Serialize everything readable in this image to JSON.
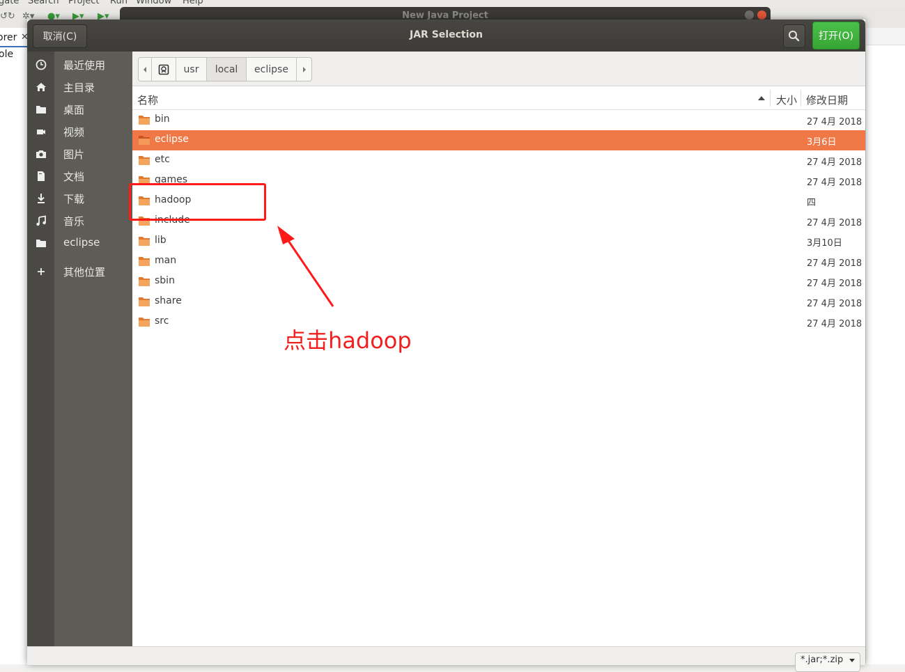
{
  "background_window": {
    "menu_items": [
      "gate",
      "Search",
      "Project",
      "Run",
      "Window",
      "Help"
    ],
    "behind_dialog_title": "New Java Project",
    "explorer_tab": "orer",
    "explorer_row": "ole"
  },
  "dialog": {
    "title": "JAR Selection",
    "cancel_label": "取消(C)",
    "open_label": "打开(O)"
  },
  "sidebar": {
    "places": [
      {
        "label": "最近使用",
        "icon": "clock-icon"
      },
      {
        "label": "主目录",
        "icon": "home-icon"
      },
      {
        "label": "桌面",
        "icon": "folder-icon"
      },
      {
        "label": "视频",
        "icon": "video-icon"
      },
      {
        "label": "图片",
        "icon": "camera-icon"
      },
      {
        "label": "文档",
        "icon": "document-icon"
      },
      {
        "label": "下载",
        "icon": "download-icon"
      },
      {
        "label": "音乐",
        "icon": "music-icon"
      },
      {
        "label": "eclipse",
        "icon": "folder-icon"
      }
    ],
    "other_locations": "其他位置"
  },
  "path_bar": {
    "crumbs": [
      "usr",
      "local",
      "eclipse"
    ],
    "active_index": 1
  },
  "columns": {
    "name": "名称",
    "size": "大小",
    "modified": "修改日期"
  },
  "files": [
    {
      "name": "bin",
      "modified": "27 4月 2018"
    },
    {
      "name": "eclipse",
      "modified": "3月6日"
    },
    {
      "name": "etc",
      "modified": "27 4月 2018"
    },
    {
      "name": "games",
      "modified": "27 4月 2018"
    },
    {
      "name": "hadoop",
      "modified": "四"
    },
    {
      "name": "include",
      "modified": "27 4月 2018"
    },
    {
      "name": "lib",
      "modified": "3月10日"
    },
    {
      "name": "man",
      "modified": "27 4月 2018"
    },
    {
      "name": "sbin",
      "modified": "27 4月 2018"
    },
    {
      "name": "share",
      "modified": "27 4月 2018"
    },
    {
      "name": "src",
      "modified": "27 4月 2018"
    }
  ],
  "selected_file": "eclipse",
  "filter": {
    "value": "*.jar;*.zip"
  },
  "annotation": {
    "text": "点击hadoop"
  },
  "colors": {
    "selection": "#f07746",
    "open_button": "#3fb23d",
    "header": "#3c3b37",
    "sidebar": "#5d5c56",
    "annotation": "#ff1a1a"
  }
}
